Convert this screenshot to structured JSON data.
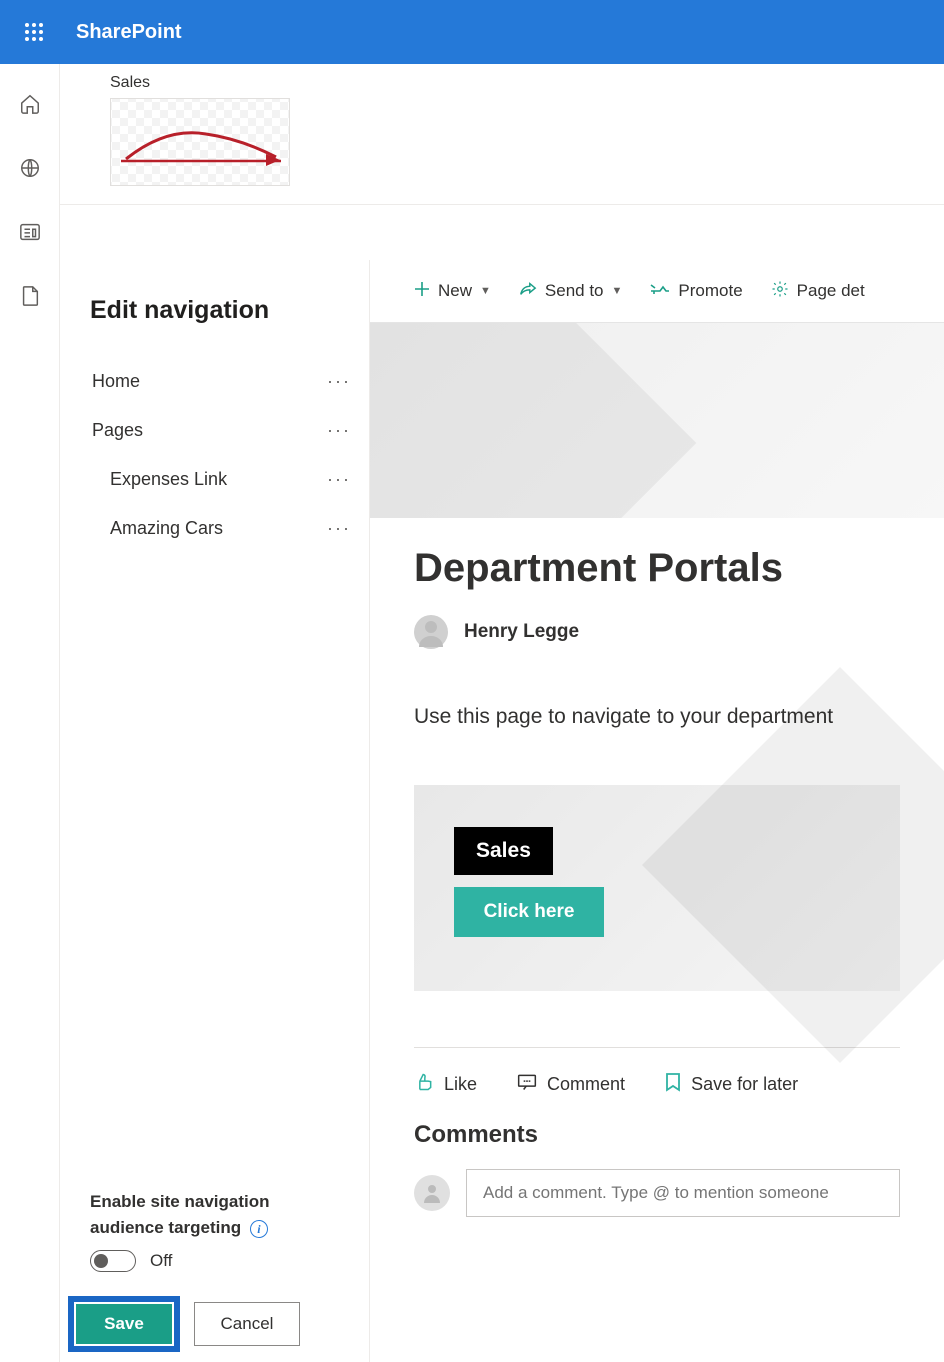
{
  "header": {
    "app_name": "SharePoint"
  },
  "site": {
    "title": "Sales"
  },
  "nav_panel": {
    "heading": "Edit navigation",
    "items": [
      {
        "label": "Home",
        "indent": false
      },
      {
        "label": "Pages",
        "indent": false
      },
      {
        "label": "Expenses Link",
        "indent": true
      },
      {
        "label": "Amazing Cars",
        "indent": true
      }
    ],
    "targeting": {
      "label_line1": "Enable site navigation",
      "label_line2": "audience targeting",
      "state_text": "Off"
    },
    "buttons": {
      "save": "Save",
      "cancel": "Cancel"
    }
  },
  "commands": {
    "new": "New",
    "send_to": "Send to",
    "promote": "Promote",
    "page_details": "Page det"
  },
  "page": {
    "title": "Department Portals",
    "author": "Henry Legge",
    "description": "Use this page to navigate to your department",
    "tile": {
      "label": "Sales",
      "button": "Click here"
    },
    "social": {
      "like": "Like",
      "comment": "Comment",
      "save": "Save for later"
    },
    "comments_heading": "Comments",
    "comment_placeholder": "Add a comment. Type @ to mention someone"
  }
}
